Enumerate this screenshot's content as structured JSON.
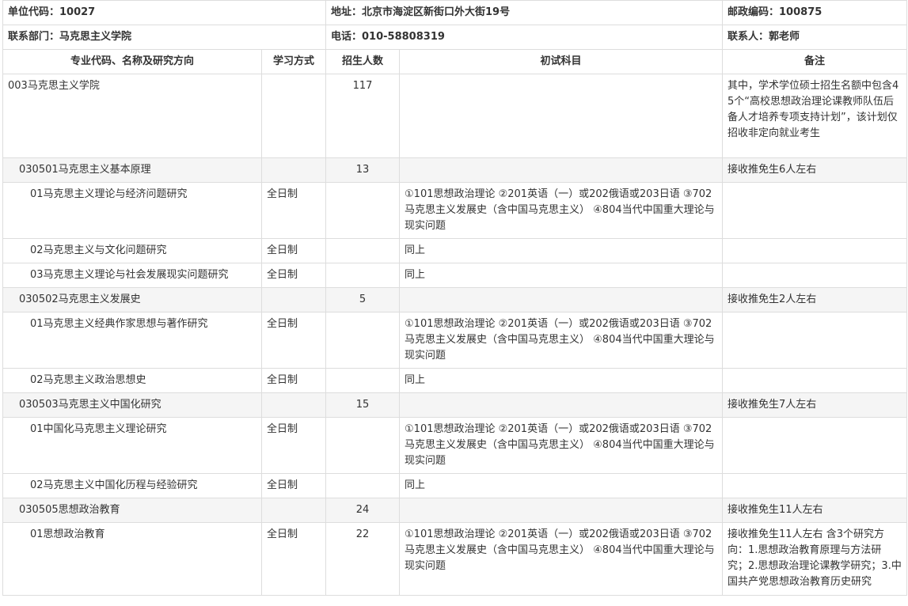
{
  "header": {
    "unit_code": "单位代码：10027",
    "address": "地址：北京市海淀区新街口外大街19号",
    "postcode": "邮政编码：100875",
    "department": "联系部门：马克思主义学院",
    "phone": "电话：010-58808319",
    "contact": "联系人：郭老师"
  },
  "columns": [
    "专业代码、名称及研究方向",
    "学习方式",
    "招生人数",
    "初试科目",
    "备注"
  ],
  "rows": [
    {
      "name": "003马克思主义学院",
      "mode": "",
      "count": "117",
      "subjects": "",
      "note": "其中，学术学位硕士招生名额中包含45个“高校思想政治理论课教师队伍后备人才培养专项支持计划”，该计划仅招收非定向就业考生"
    },
    {
      "name": "030501马克思主义基本原理",
      "mode": "",
      "count": "13",
      "subjects": "",
      "note": "接收推免生6人左右"
    },
    {
      "name": "01马克思主义理论与经济问题研究",
      "mode": "全日制",
      "count": "",
      "subjects": "①101思想政治理论 ②201英语（一）或202俄语或203日语 ③702马克思主义发展史（含中国马克思主义） ④804当代中国重大理论与现实问题",
      "note": ""
    },
    {
      "name": "02马克思主义与文化问题研究",
      "mode": "全日制",
      "count": "",
      "subjects": "同上",
      "note": ""
    },
    {
      "name": "03马克思主义理论与社会发展现实问题研究",
      "mode": "全日制",
      "count": "",
      "subjects": "同上",
      "note": ""
    },
    {
      "name": "030502马克思主义发展史",
      "mode": "",
      "count": "5",
      "subjects": "",
      "note": "接收推免生2人左右"
    },
    {
      "name": "01马克思主义经典作家思想与著作研究",
      "mode": "全日制",
      "count": "",
      "subjects": "①101思想政治理论 ②201英语（一）或202俄语或203日语 ③702马克思主义发展史（含中国马克思主义） ④804当代中国重大理论与现实问题",
      "note": ""
    },
    {
      "name": "02马克思主义政治思想史",
      "mode": "全日制",
      "count": "",
      "subjects": "同上",
      "note": ""
    },
    {
      "name": "030503马克思主义中国化研究",
      "mode": "",
      "count": "15",
      "subjects": "",
      "note": "接收推免生7人左右"
    },
    {
      "name": "01中国化马克思主义理论研究",
      "mode": "全日制",
      "count": "",
      "subjects": "①101思想政治理论 ②201英语（一）或202俄语或203日语 ③702马克思主义发展史（含中国马克思主义） ④804当代中国重大理论与现实问题",
      "note": ""
    },
    {
      "name": "02马克思主义中国化历程与经验研究",
      "mode": "全日制",
      "count": "",
      "subjects": "同上",
      "note": ""
    },
    {
      "name": "030505思想政治教育",
      "mode": "",
      "count": "24",
      "subjects": "",
      "note": "接收推免生11人左右"
    },
    {
      "name": "01思想政治教育",
      "mode": "全日制",
      "count": "22",
      "subjects": "①101思想政治理论 ②201英语（一）或202俄语或203日语 ③702马克思主义发展史（含中国马克思主义） ④804当代中国重大理论与现实问题",
      "note": "接收推免生11人左右 含3个研究方向：1.思想政治教育原理与方法研究；2.思想政治理论课教学研究；3.中国共产党思想政治教育历史研究"
    }
  ]
}
